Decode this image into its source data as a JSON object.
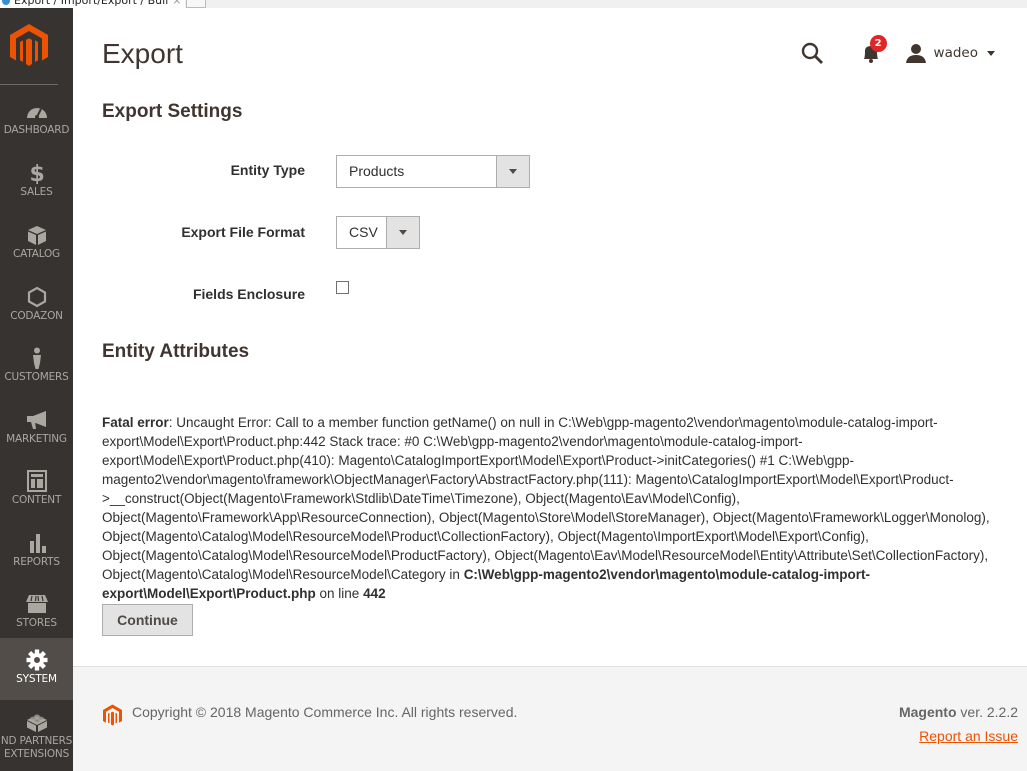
{
  "browser": {
    "tab_title": "Export / Import/Export / Buil",
    "tab_close": "×"
  },
  "sidebar": {
    "items": [
      {
        "label": "DASHBOARD",
        "icon": "dashboard-icon",
        "active": false
      },
      {
        "label": "SALES",
        "icon": "dollar-icon",
        "active": false
      },
      {
        "label": "CATALOG",
        "icon": "box-icon",
        "active": false
      },
      {
        "label": "CODAZON",
        "icon": "hexagon-icon",
        "active": false
      },
      {
        "label": "CUSTOMERS",
        "icon": "person-icon",
        "active": false
      },
      {
        "label": "MARKETING",
        "icon": "megaphone-icon",
        "active": false
      },
      {
        "label": "CONTENT",
        "icon": "layout-icon",
        "active": false
      },
      {
        "label": "REPORTS",
        "icon": "bar-chart-icon",
        "active": false
      },
      {
        "label": "STORES",
        "icon": "storefront-icon",
        "active": false
      },
      {
        "label": "SYSTEM",
        "icon": "gear-icon",
        "active": true
      },
      {
        "label": "FIND PARTNERS & EXTENSIONS",
        "label_line1": "ND PARTNERS",
        "label_line2": "EXTENSIONS",
        "icon": "lego-block-icon",
        "active": false
      }
    ]
  },
  "header": {
    "title": "Export",
    "notification_count": "2",
    "username": "wadeo"
  },
  "export_settings": {
    "title": "Export Settings",
    "entity_type": {
      "label": "Entity Type",
      "value": "Products"
    },
    "file_format": {
      "label": "Export File Format",
      "value": "CSV"
    },
    "fields_enclosure": {
      "label": "Fields Enclosure",
      "checked": false
    }
  },
  "entity_attributes": {
    "title": "Entity Attributes"
  },
  "error": {
    "label": "Fatal error",
    "message": ": Uncaught Error: Call to a member function getName() on null in C:\\Web\\gpp-magento2\\vendor\\magento\\module-catalog-import-export\\Model\\Export\\Product.php:442 Stack trace: #0 C:\\Web\\gpp-magento2\\vendor\\magento\\module-catalog-import-export\\Model\\Export\\Product.php(410): Magento\\CatalogImportExport\\Model\\Export\\Product->initCategories() #1 C:\\Web\\gpp-magento2\\vendor\\magento\\framework\\ObjectManager\\Factory\\AbstractFactory.php(111): Magento\\CatalogImportExport\\Model\\Export\\Product->__construct(Object(Magento\\Framework\\Stdlib\\DateTime\\Timezone), Object(Magento\\Eav\\Model\\Config), Object(Magento\\Framework\\App\\ResourceConnection), Object(Magento\\Store\\Model\\StoreManager), Object(Magento\\Framework\\Logger\\Monolog), Object(Magento\\Catalog\\Model\\ResourceModel\\Product\\CollectionFactory), Object(Magento\\ImportExport\\Model\\Export\\Config), Object(Magento\\Catalog\\Model\\ResourceModel\\ProductFactory), Object(Magento\\Eav\\Model\\ResourceModel\\Entity\\Attribute\\Set\\CollectionFactory), Object(Magento\\Catalog\\Model\\ResourceModel\\Category in ",
    "file": "C:\\Web\\gpp-magento2\\vendor\\magento\\module-catalog-import-export\\Model\\Export\\Product.php",
    "on_line_text": " on line ",
    "line": "442",
    "continue_label": "Continue"
  },
  "footer": {
    "copyright": "Copyright © 2018 Magento Commerce Inc. All rights reserved.",
    "brand": "Magento",
    "version": " ver. 2.2.2",
    "report_link": "Report an Issue"
  },
  "colors": {
    "brand_orange": "#eb5202",
    "sidebar_bg": "#373330",
    "sidebar_active": "#524d49",
    "badge_red": "#e22626",
    "footer_bg": "#f4f4f4"
  }
}
